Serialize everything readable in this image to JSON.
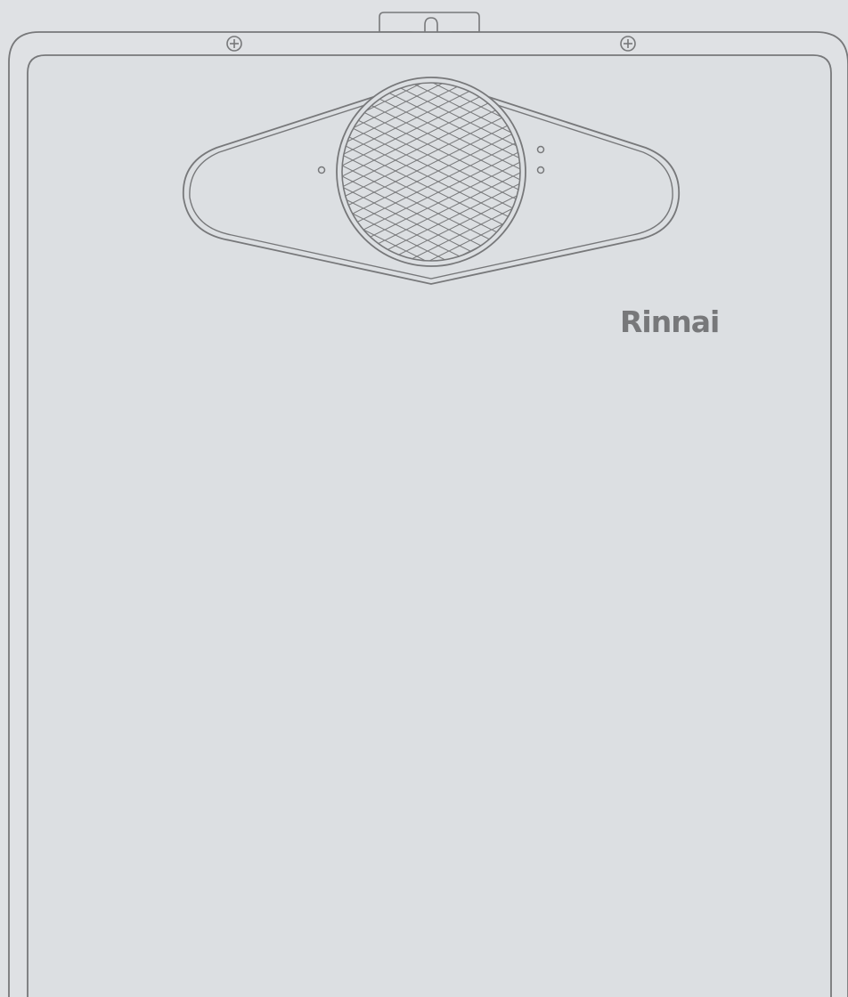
{
  "brand": {
    "name": "Rinnai"
  },
  "colors": {
    "background": "#dfe1e4",
    "panel": "#dcdfe2",
    "outline": "#77787a"
  },
  "icons": {
    "left_screw": "phillips-screw-icon",
    "right_screw": "phillips-screw-icon",
    "grille": "diamond-mesh-grille-icon",
    "left_light": "status-light-icon",
    "right_lights": "status-light-icon"
  }
}
